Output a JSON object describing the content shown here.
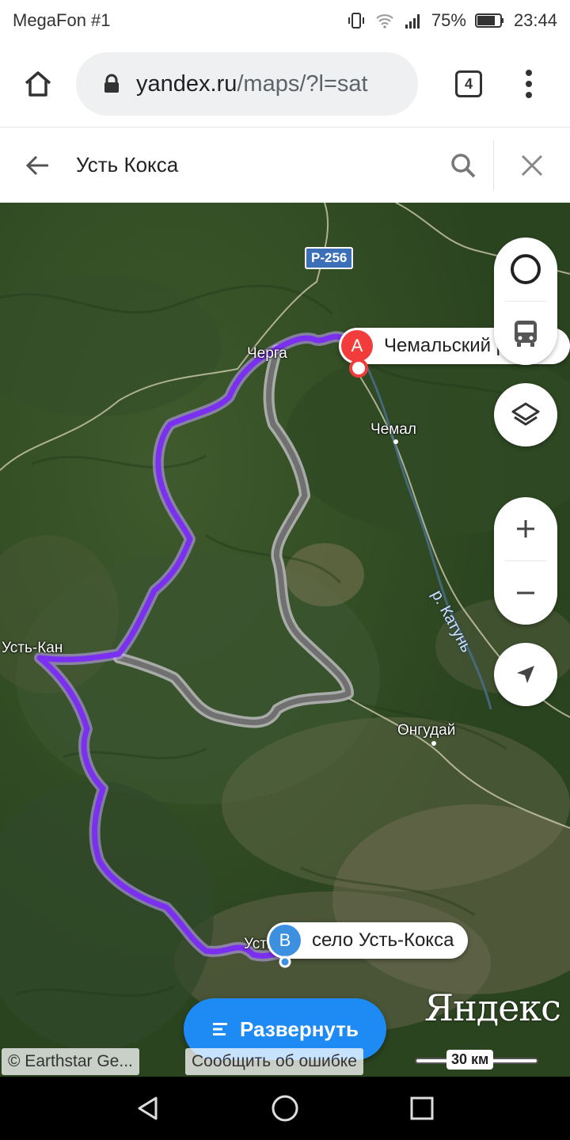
{
  "status_bar": {
    "carrier": "MegaFon #1",
    "battery": "75%",
    "time": "23:44"
  },
  "browser": {
    "url_host": "yandex.ru",
    "url_path": "/maps/?l=sat",
    "tab_count": "4"
  },
  "search": {
    "query": "Усть Кокса"
  },
  "map": {
    "road_shield": "Р-256",
    "places": {
      "cherga": "Черга",
      "chemal": "Чемал",
      "ust_kan": "Усть-Кан",
      "ongudai": "Онгудай",
      "ust_partial": "Усть"
    },
    "river": "р. Катунь",
    "point_a": {
      "badge": "A",
      "label": "Чемальский район",
      "color": "#f23c3c"
    },
    "point_b": {
      "badge": "B",
      "label": "село Усть-Кокса",
      "color": "#3d8fe0"
    },
    "route_colors": {
      "active": "#7b2ff0",
      "alternative": "#8c8c8c"
    },
    "expand_label": "Развернуть",
    "brand": "Яндекс",
    "attribution": "© Earthstar Ge...",
    "report_error": "Сообщить об ошибке",
    "scale": "30 км"
  },
  "icons": {
    "status": [
      "vibrate-icon",
      "wifi-icon",
      "signal-icon",
      "battery-icon"
    ],
    "controls": [
      "traffic-icon",
      "transit-bus-icon",
      "layers-icon",
      "zoom-in-icon",
      "zoom-out-icon",
      "locate-icon"
    ],
    "nav": [
      "back-triangle-icon",
      "home-circle-icon",
      "recents-square-icon"
    ]
  }
}
